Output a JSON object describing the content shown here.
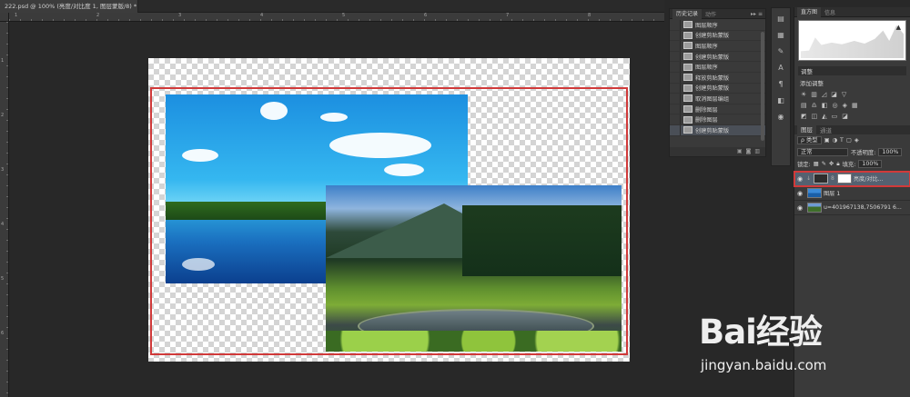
{
  "document": {
    "tab_title": "222.psd @ 100% (亮度/对比度 1, 图层蒙版/8) *",
    "tab_close": "×",
    "ruler_ticks_top": [
      "1",
      "2",
      "3",
      "4",
      "5",
      "6",
      "7",
      "8"
    ],
    "ruler_ticks_left": [
      "1",
      "2",
      "3",
      "4",
      "5",
      "6"
    ]
  },
  "history": {
    "tabs": [
      "历史记录",
      "动作"
    ],
    "controls": "▸▸ ≡",
    "items": [
      {
        "label": "图层顺序",
        "active": false
      },
      {
        "label": "创建剪贴蒙版",
        "active": false
      },
      {
        "label": "图层顺序",
        "active": false
      },
      {
        "label": "创建剪贴蒙版",
        "active": false
      },
      {
        "label": "图层顺序",
        "active": false
      },
      {
        "label": "释放剪贴蒙版",
        "active": false
      },
      {
        "label": "创建剪贴蒙版",
        "active": false
      },
      {
        "label": "取消图层编组",
        "active": false
      },
      {
        "label": "删除图层",
        "active": false
      },
      {
        "label": "删除图层",
        "active": false
      },
      {
        "label": "创建剪贴蒙版",
        "active": true
      }
    ]
  },
  "histogram": {
    "tabs": [
      "直方图",
      "信息"
    ],
    "warning": "▲"
  },
  "adjustments": {
    "tab": "调整",
    "add_label": "添加调整"
  },
  "layers": {
    "tabs": [
      "图层",
      "通道"
    ],
    "filter_kind": "ρ 类型",
    "blend_mode": "正常",
    "opacity_label": "不透明度:",
    "opacity_value": "100%",
    "lock_label": "锁定:",
    "fill_label": "填充:",
    "fill_value": "100%",
    "rows": [
      {
        "name": "亮度/对比...",
        "kind": "adjustment",
        "selected": true
      },
      {
        "name": "图层 1",
        "kind": "pic1",
        "selected": false
      },
      {
        "name": "u=401967138,7506791 6...",
        "kind": "pic2",
        "selected": false
      }
    ]
  },
  "watermark": {
    "logo": "Bai经验",
    "url": "jingyan.baidu.com"
  }
}
